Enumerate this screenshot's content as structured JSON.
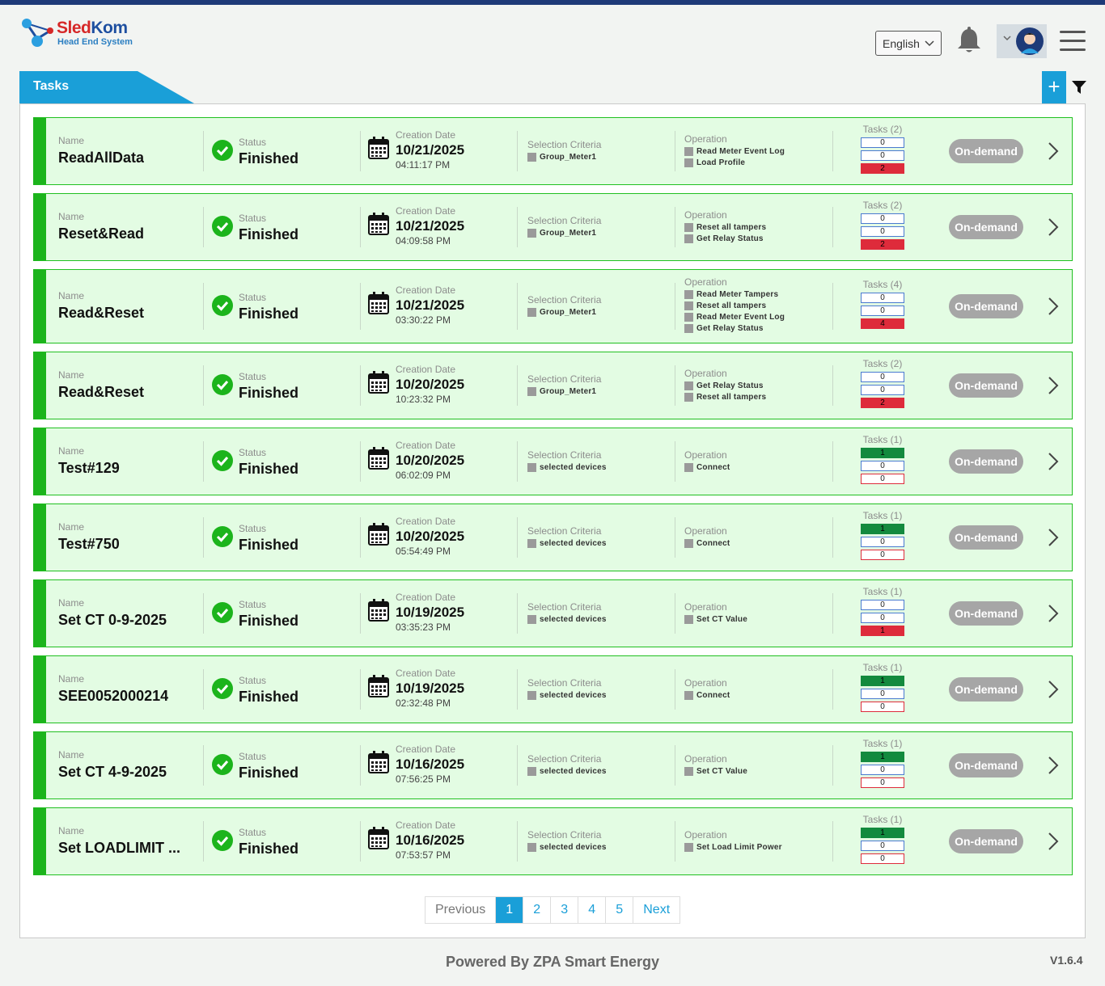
{
  "app": {
    "logo_title_a": "Sled",
    "logo_title_b": "Kom",
    "logo_sub": "Head End System",
    "language": "English",
    "tab_title": "Tasks",
    "add_symbol": "+"
  },
  "labels": {
    "name": "Name",
    "status": "Status",
    "creation_date": "Creation Date",
    "selection_criteria": "Selection Criteria",
    "operation": "Operation"
  },
  "tasks": [
    {
      "name": "ReadAllData",
      "status": "Finished",
      "date": "10/21/2025",
      "time": "04:11:17 PM",
      "selection": "Group_Meter1",
      "operations": [
        "Read Meter Event Log",
        "Load Profile"
      ],
      "tasks_label": "Tasks (2)",
      "counts": [
        "0",
        "0",
        "2"
      ],
      "type": "On-demand"
    },
    {
      "name": "Reset&Read",
      "status": "Finished",
      "date": "10/21/2025",
      "time": "04:09:58 PM",
      "selection": "Group_Meter1",
      "operations": [
        "Reset all tampers",
        "Get Relay Status"
      ],
      "tasks_label": "Tasks (2)",
      "counts": [
        "0",
        "0",
        "2"
      ],
      "type": "On-demand"
    },
    {
      "name": "Read&Reset",
      "status": "Finished",
      "date": "10/21/2025",
      "time": "03:30:22 PM",
      "selection": "Group_Meter1",
      "operations": [
        "Read Meter Tampers",
        "Reset all tampers",
        "Read Meter Event Log",
        "Get Relay Status"
      ],
      "tasks_label": "Tasks (4)",
      "counts": [
        "0",
        "0",
        "4"
      ],
      "type": "On-demand"
    },
    {
      "name": "Read&Reset",
      "status": "Finished",
      "date": "10/20/2025",
      "time": "10:23:32 PM",
      "selection": "Group_Meter1",
      "operations": [
        "Get Relay Status",
        "Reset all tampers"
      ],
      "tasks_label": "Tasks (2)",
      "counts": [
        "0",
        "0",
        "2"
      ],
      "type": "On-demand"
    },
    {
      "name": "Test#129",
      "status": "Finished",
      "date": "10/20/2025",
      "time": "06:02:09 PM",
      "selection": "selected devices",
      "operations": [
        "Connect"
      ],
      "tasks_label": "Tasks (1)",
      "counts": [
        "1",
        "0",
        "0"
      ],
      "type": "On-demand"
    },
    {
      "name": "Test#750",
      "status": "Finished",
      "date": "10/20/2025",
      "time": "05:54:49 PM",
      "selection": "selected devices",
      "operations": [
        "Connect"
      ],
      "tasks_label": "Tasks (1)",
      "counts": [
        "1",
        "0",
        "0"
      ],
      "type": "On-demand"
    },
    {
      "name": "Set CT 0-9-2025",
      "status": "Finished",
      "date": "10/19/2025",
      "time": "03:35:23 PM",
      "selection": "selected devices",
      "operations": [
        "Set CT Value"
      ],
      "tasks_label": "Tasks (1)",
      "counts": [
        "0",
        "0",
        "1"
      ],
      "type": "On-demand"
    },
    {
      "name": "SEE0052000214",
      "status": "Finished",
      "date": "10/19/2025",
      "time": "02:32:48 PM",
      "selection": "selected devices",
      "operations": [
        "Connect"
      ],
      "tasks_label": "Tasks (1)",
      "counts": [
        "1",
        "0",
        "0"
      ],
      "type": "On-demand"
    },
    {
      "name": "Set CT 4-9-2025",
      "status": "Finished",
      "date": "10/16/2025",
      "time": "07:56:25 PM",
      "selection": "selected devices",
      "operations": [
        "Set CT Value"
      ],
      "tasks_label": "Tasks (1)",
      "counts": [
        "1",
        "0",
        "0"
      ],
      "type": "On-demand"
    },
    {
      "name": "Set LOADLIMIT ...",
      "status": "Finished",
      "date": "10/16/2025",
      "time": "07:53:57 PM",
      "selection": "selected devices",
      "operations": [
        "Set Load Limit Power"
      ],
      "tasks_label": "Tasks (1)",
      "counts": [
        "1",
        "0",
        "0"
      ],
      "type": "On-demand"
    }
  ],
  "pagination": {
    "previous": "Previous",
    "pages": [
      "1",
      "2",
      "3",
      "4",
      "5"
    ],
    "active": "1",
    "next": "Next"
  },
  "footer": {
    "powered": "Powered By ZPA Smart Energy",
    "version": "V1.6.4"
  },
  "colors": {
    "accent": "#1a9fd8",
    "success_bar": "#1cb41c",
    "card_bg": "#e3fce3",
    "done": "#138a3e",
    "failed": "#de2b3b",
    "header_line": "#1e3a78"
  }
}
